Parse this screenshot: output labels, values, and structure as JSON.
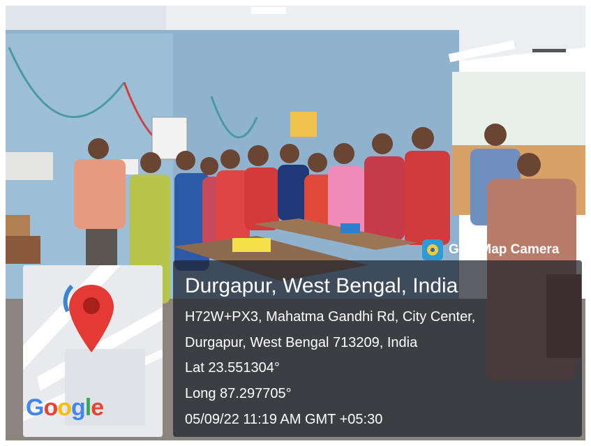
{
  "overlay": {
    "app_name": "GPS Map Camera",
    "location_title": "Durgapur, West Bengal, India",
    "address_line1": "H72W+PX3, Mahatma Gandhi Rd, City Center,",
    "address_line2": "Durgapur, West Bengal 713209, India",
    "latitude": "Lat 23.551304°",
    "longitude": "Long 87.297705°",
    "datetime": "05/09/22 11:19 AM GMT +05:30"
  },
  "map": {
    "brand": "Google",
    "pin_color": "#e53935",
    "brand_colors": [
      "#4285F4",
      "#EA4335",
      "#FBBC05",
      "#4285F4",
      "#34A853",
      "#EA4335"
    ]
  },
  "colors": {
    "wall": "#8fb3cf",
    "ceiling": "#e6eaee",
    "overlay_bg": "#1e222c"
  }
}
